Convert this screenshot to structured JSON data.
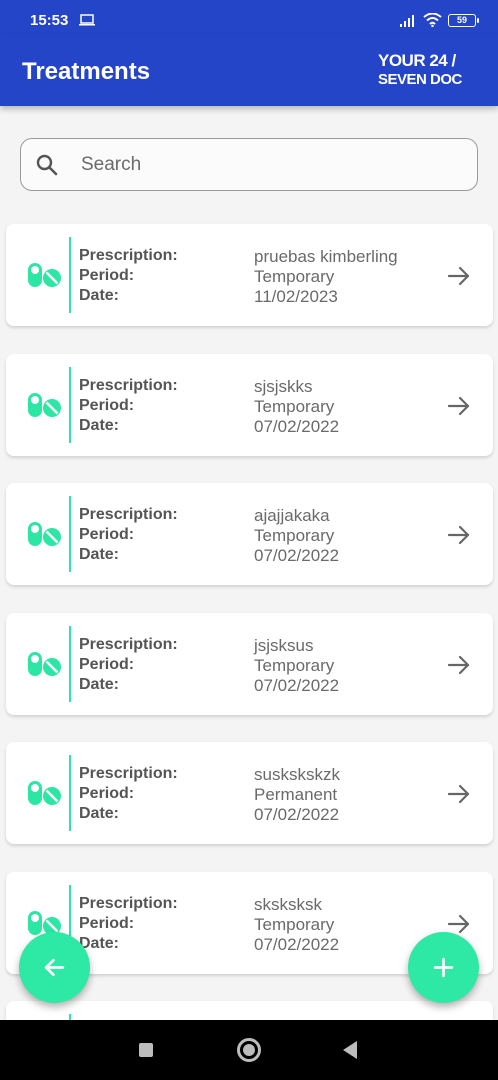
{
  "status_bar": {
    "time": "15:53",
    "battery": "59",
    "icons": [
      "laptop-icon",
      "signal-icon",
      "wifi-icon",
      "battery-icon"
    ]
  },
  "header": {
    "title": "Treatments",
    "logo_line1": "YOUR 24 /",
    "logo_line2": "SEVEN DOC"
  },
  "search": {
    "placeholder": "Search",
    "value": ""
  },
  "labels": {
    "prescription": "Prescription:",
    "period": "Period:",
    "date": "Date:"
  },
  "treatments": [
    {
      "prescription": "pruebas kimberling",
      "period": "Temporary",
      "date": "11/02/2023"
    },
    {
      "prescription": "sjsjskks",
      "period": "Temporary",
      "date": "07/02/2022"
    },
    {
      "prescription": "ajajjakaka",
      "period": "Temporary",
      "date": "07/02/2022"
    },
    {
      "prescription": "jsjsksus",
      "period": "Temporary",
      "date": "07/02/2022"
    },
    {
      "prescription": "suskskskzk",
      "period": "Permanent",
      "date": "07/02/2022"
    },
    {
      "prescription": "sksksksk",
      "period": "Temporary",
      "date": "07/02/2022"
    }
  ],
  "colors": {
    "primary": "#2545c9",
    "accent": "#2ee8a6",
    "card_divider": "#2ce6a4"
  },
  "fab": {
    "back_icon": "arrow-left-icon",
    "add_icon": "plus-icon"
  }
}
